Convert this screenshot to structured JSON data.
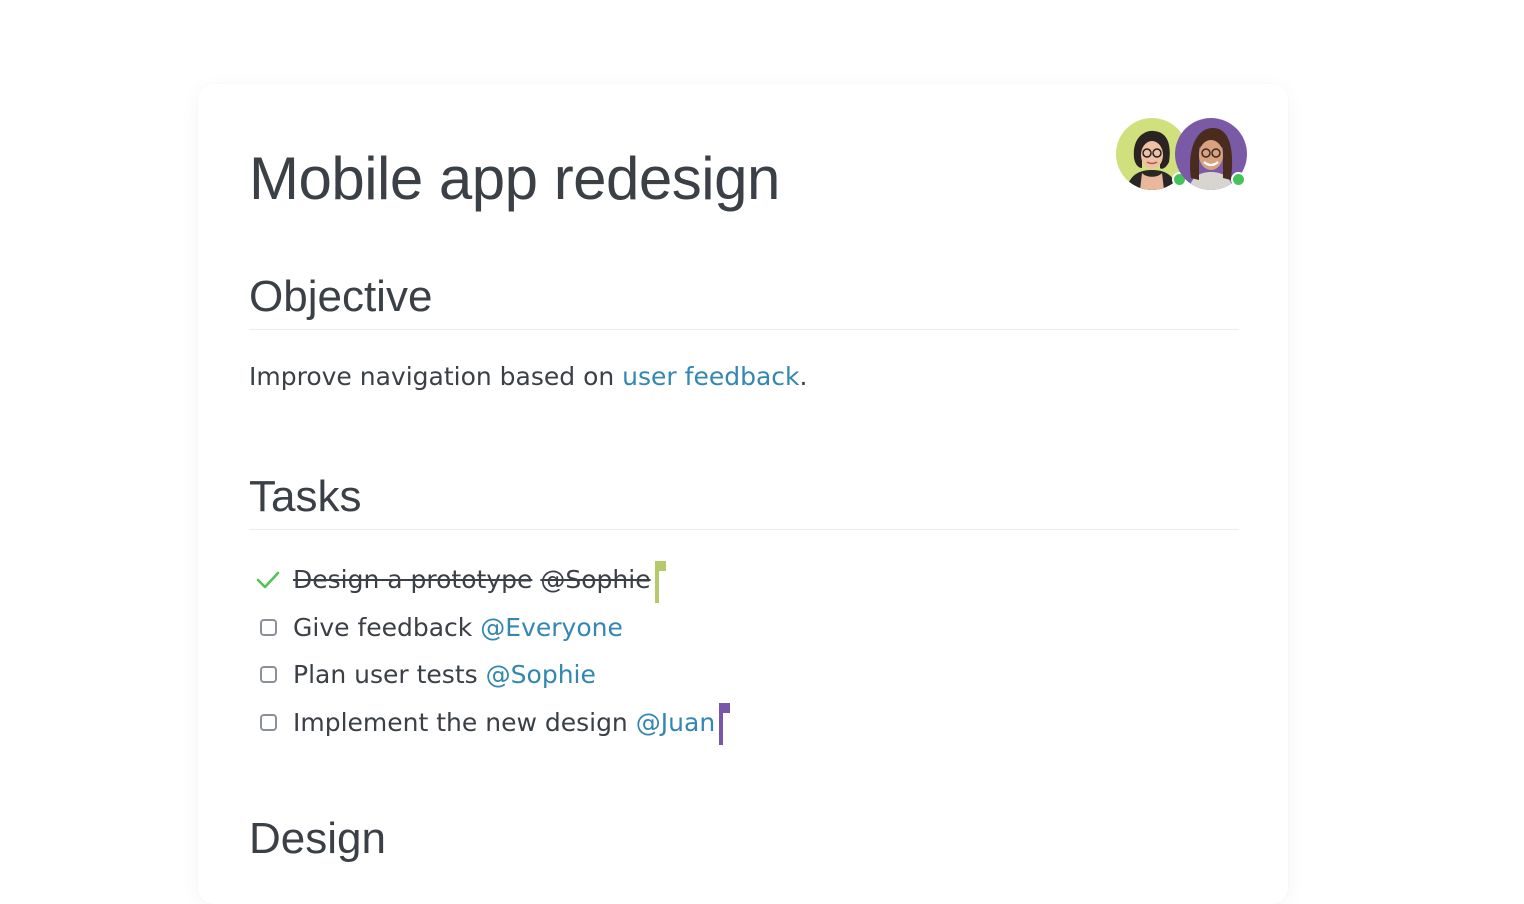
{
  "document": {
    "title": "Mobile app redesign",
    "collaborators": [
      {
        "icon": "avatar-woman-glasses",
        "status": "online",
        "bg": "#cfe07d"
      },
      {
        "icon": "avatar-woman-smiling",
        "status": "online",
        "bg": "#7a5aa6"
      }
    ],
    "sections": {
      "objective": {
        "heading": "Objective",
        "text_before": "Improve navigation based on ",
        "link_text": "user feedback",
        "text_after": "."
      },
      "tasks": {
        "heading": "Tasks",
        "items": [
          {
            "label": "Design a prototype",
            "mention": "@Sophie",
            "done": true,
            "cursor_color": "#b6c96a"
          },
          {
            "label": "Give feedback",
            "mention": "@Everyone",
            "done": false
          },
          {
            "label": "Plan user tests",
            "mention": "@Sophie",
            "done": false
          },
          {
            "label": "Implement the new design",
            "mention": "@Juan",
            "done": false,
            "cursor_color": "#7857a8"
          }
        ]
      },
      "design": {
        "heading": "Design"
      }
    }
  },
  "colors": {
    "text": "#3b4047",
    "link": "#3387b0",
    "check": "#52c25a",
    "online": "#44c35a"
  }
}
